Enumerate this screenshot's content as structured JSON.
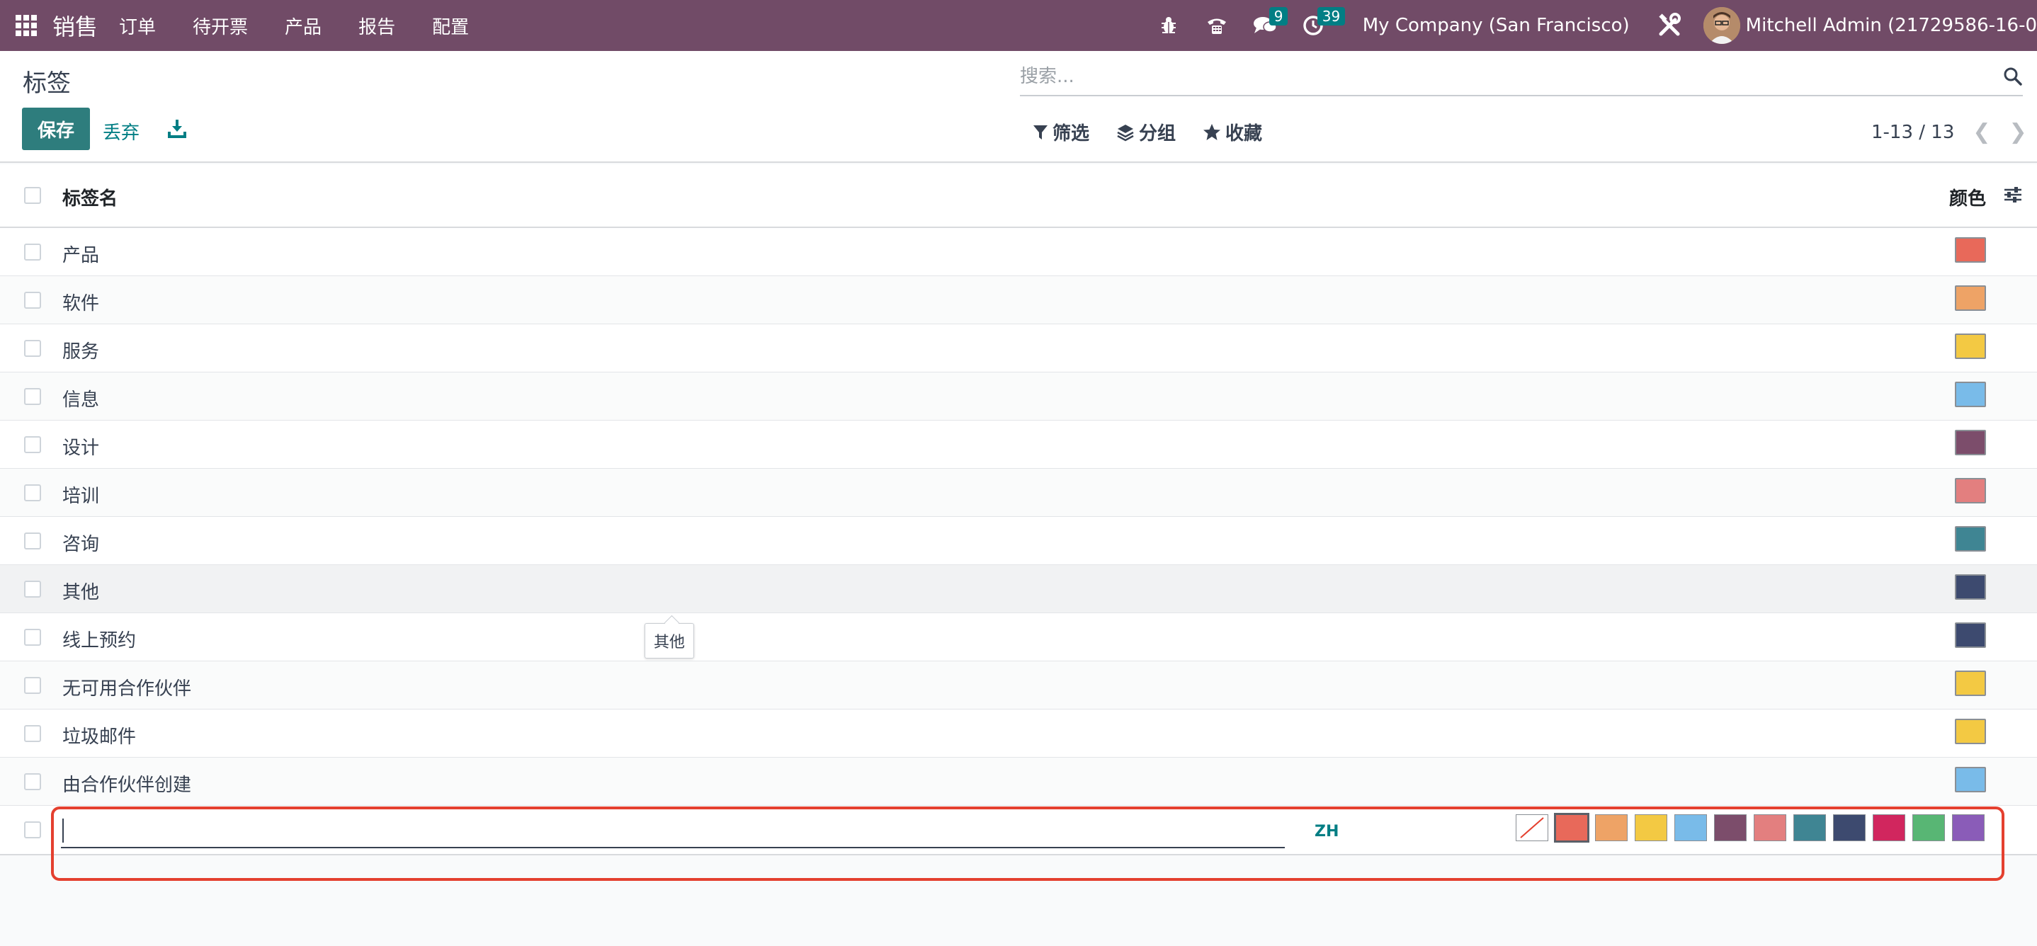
{
  "navbar": {
    "app_name": "销售",
    "menu": [
      "订单",
      "待开票",
      "产品",
      "报告",
      "配置"
    ],
    "messages_count": "9",
    "activities_count": "39",
    "company": "My Company (San Francisco)",
    "user": "Mitchell Admin (21729586-16-0"
  },
  "control": {
    "title": "标签",
    "save_label": "保存",
    "discard_label": "丢弃",
    "search_placeholder": "搜索...",
    "filter_label": "筛选",
    "group_label": "分组",
    "favorites_label": "收藏",
    "pager": "1-13 / 13"
  },
  "list": {
    "col_name": "标签名",
    "col_color": "颜色",
    "rows": [
      {
        "name": "产品",
        "color": "#e8695a"
      },
      {
        "name": "软件",
        "color": "#eea366"
      },
      {
        "name": "服务",
        "color": "#f3c943"
      },
      {
        "name": "信息",
        "color": "#79bbe9"
      },
      {
        "name": "设计",
        "color": "#7c4d6b"
      },
      {
        "name": "培训",
        "color": "#e37f7f"
      },
      {
        "name": "咨询",
        "color": "#3f8593"
      },
      {
        "name": "其他",
        "color": "#3d4a6f"
      },
      {
        "name": "线上预约",
        "color": "#3d4a6f"
      },
      {
        "name": "无可用合作伙伴",
        "color": "#f3c943"
      },
      {
        "name": "垃圾邮件",
        "color": "#f3c943"
      },
      {
        "name": "由合作伙伴创建",
        "color": "#79bbe9"
      }
    ]
  },
  "new_row": {
    "lang_badge": "ZH",
    "palette": [
      "none",
      "#e8695a",
      "#eea366",
      "#f3c943",
      "#79bbe9",
      "#7c4d6b",
      "#e37f7f",
      "#3f8593",
      "#3d4a6f",
      "#d1265e",
      "#58b674",
      "#8a5cb8"
    ],
    "selected": 1
  },
  "tooltip": "其他"
}
